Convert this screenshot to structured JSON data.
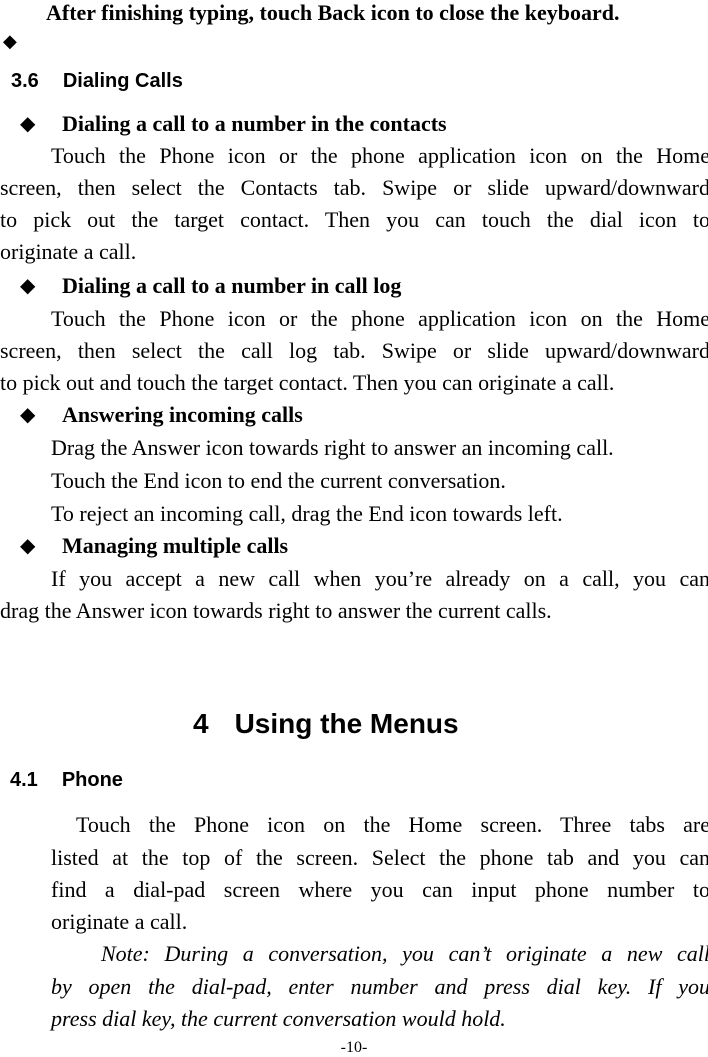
{
  "top_note": "After finishing typing, touch Back icon to close the keyboard.",
  "section_3_6": {
    "number": "3.6",
    "title": "Dialing Calls",
    "bullets": [
      {
        "heading": "Dialing a call to a number in the contacts",
        "lines": [
          "Touch the Phone icon or the phone application icon on the Home",
          "screen, then select the Contacts tab. Swipe or slide upward/downward",
          "to pick out the target contact. Then you can touch the dial icon to",
          "originate a call."
        ]
      },
      {
        "heading": "Dialing a call to a number in call log",
        "lines": [
          "Touch the Phone icon or the phone application icon on the Home",
          "screen, then select the call log tab. Swipe or slide upward/downward",
          "to pick out and touch the target contact. Then you can originate a call."
        ]
      },
      {
        "heading": "Answering incoming calls",
        "lines": [
          "Drag the Answer icon towards right to answer an incoming call.",
          "Touch the End icon to end the current conversation.",
          "To reject an incoming call, drag the End icon towards left."
        ]
      },
      {
        "heading": "Managing multiple calls",
        "lines": [
          "If you accept a new call when you’re already on a call, you can",
          "drag the Answer icon towards right to answer the current calls."
        ]
      }
    ]
  },
  "chapter_4": {
    "number": "4",
    "title": "Using the Menus"
  },
  "section_4_1": {
    "number": "4.1",
    "title": "Phone",
    "lines": [
      "Touch the Phone icon on the Home screen. Three tabs are",
      "listed at the top of the screen. Select the phone tab and you can",
      "find a dial-pad screen where you can input phone number to",
      "originate a call."
    ],
    "note_lines": [
      "Note: During a conversation, you can’t originate a new call",
      "by open the dial-pad, enter number and press dial key. If you",
      "press dial key, the current conversation would hold."
    ]
  },
  "page_number": "-10-",
  "bullet_glyph": "◆"
}
